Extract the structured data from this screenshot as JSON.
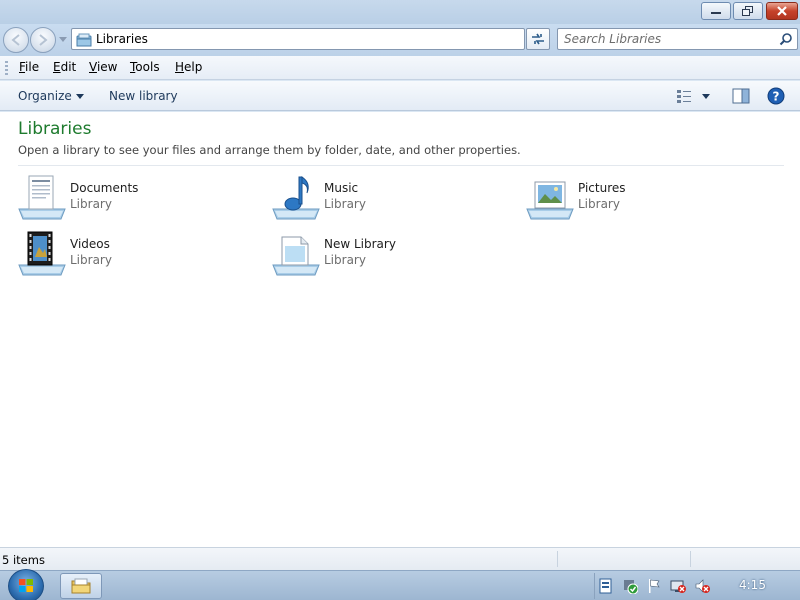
{
  "window": {
    "minimize_icon": "minimize-icon",
    "maximize_icon": "restore-icon",
    "close_icon": "close-icon"
  },
  "navbar": {
    "address": "Libraries",
    "search_placeholder": "Search Libraries"
  },
  "menu": {
    "items": [
      {
        "accel": "F",
        "rest": "ile"
      },
      {
        "accel": "E",
        "rest": "dit"
      },
      {
        "accel": "V",
        "rest": "iew"
      },
      {
        "accel": "T",
        "rest": "ools"
      },
      {
        "accel": "H",
        "rest": "elp"
      }
    ]
  },
  "commands": {
    "organize": "Organize",
    "new_library": "New library"
  },
  "content": {
    "title": "Libraries",
    "description": "Open a library to see your files and arrange them by folder, date, and other properties.",
    "libraries": [
      {
        "name": "Documents",
        "type": "Library",
        "icon": "documents-library-icon"
      },
      {
        "name": "Music",
        "type": "Library",
        "icon": "music-library-icon"
      },
      {
        "name": "Pictures",
        "type": "Library",
        "icon": "pictures-library-icon"
      },
      {
        "name": "Videos",
        "type": "Library",
        "icon": "videos-library-icon"
      },
      {
        "name": "New Library",
        "type": "Library",
        "icon": "new-library-icon"
      }
    ]
  },
  "status": {
    "items": "5 items"
  },
  "taskbar": {
    "clock": "4:15"
  },
  "colors": {
    "title_green": "#1e7b2e",
    "link_blue": "#1e395b",
    "close_red": "#c6432b"
  }
}
